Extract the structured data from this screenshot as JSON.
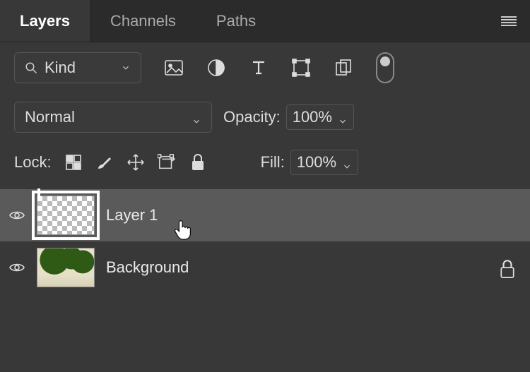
{
  "tabs": {
    "layers": "Layers",
    "channels": "Channels",
    "paths": "Paths"
  },
  "filter": {
    "kind_label": "Kind"
  },
  "blend": {
    "mode": "Normal",
    "opacity_label": "Opacity:",
    "opacity_value": "100%"
  },
  "lock": {
    "label": "Lock:",
    "fill_label": "Fill:",
    "fill_value": "100%"
  },
  "layers": [
    {
      "name": "Layer 1"
    },
    {
      "name": "Background"
    }
  ]
}
